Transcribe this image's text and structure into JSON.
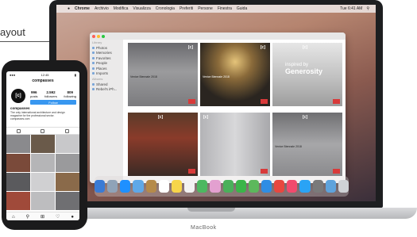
{
  "annotation": {
    "label": "ayout"
  },
  "device_brand": "MacBook",
  "menubar": {
    "apple": "",
    "items": [
      "Chrome",
      "Archivio",
      "Modifica",
      "Visualizza",
      "Cronologia",
      "Preferiti",
      "Persone",
      "Finestra",
      "Guida"
    ],
    "clock": "Tue 6:41 AM"
  },
  "finder": {
    "sidebar_heading": "Library",
    "sidebar_items": [
      "Photos",
      "Memories",
      "Favorites",
      "People",
      "Places",
      "Imports"
    ],
    "sidebar_heading2": "Albums",
    "sidebar_items2": [
      "Shared",
      "Rebel's iPh..."
    ]
  },
  "thumbs": [
    {
      "caption": "Venice Biennale 2018",
      "tag": "[c]"
    },
    {
      "caption": "Venice Biennale 2018",
      "tag": "[c]"
    },
    {
      "caption": "inspired by Generosity",
      "tag": "[c]"
    },
    {
      "caption": "",
      "tag": "[c]"
    },
    {
      "caption": "",
      "tag": "[c]"
    },
    {
      "caption": "Venice Biennale 2018",
      "tag": "[c]"
    }
  ],
  "generosity": {
    "line1": "inspired by",
    "line2": "Generosity"
  },
  "phone": {
    "status_time": "12:45",
    "username": "compasses",
    "avatar_text": "[c]",
    "stats": [
      {
        "num": "996",
        "label": "posts"
      },
      {
        "num": "2.592",
        "label": "followers"
      },
      {
        "num": "809",
        "label": "following"
      }
    ],
    "follow_label": "Follow",
    "name": "compasses",
    "bio": "The only international architecture and design magazine for the professional sector. compasses.com"
  }
}
